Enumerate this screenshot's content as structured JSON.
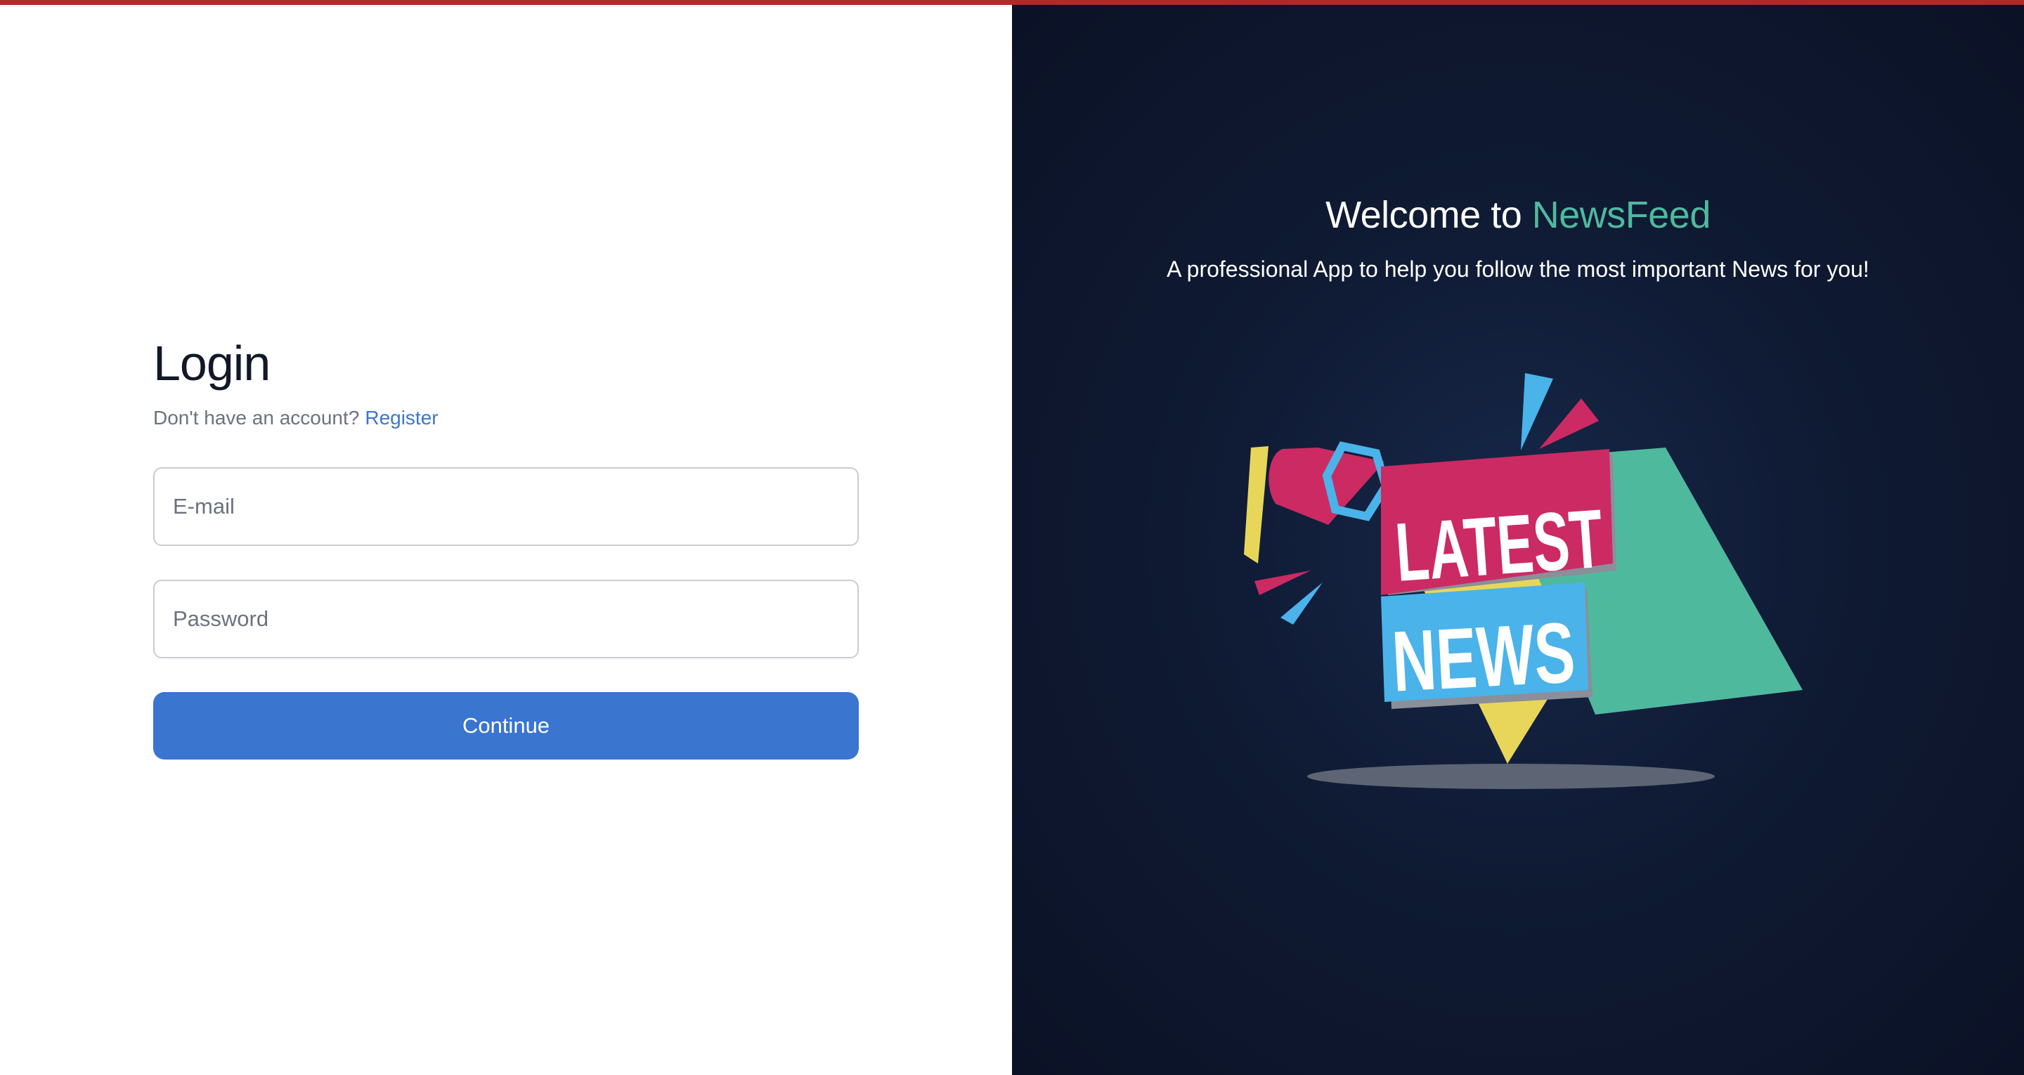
{
  "login": {
    "title": "Login",
    "no_account_text": "Don't have an account?",
    "register_label": "Register",
    "email_placeholder": "E-mail",
    "password_placeholder": "Password",
    "continue_label": "Continue"
  },
  "hero": {
    "welcome_prefix": "Welcome to",
    "brand_name": "NewsFeed",
    "tagline": "A professional App to help you follow the most important News for you!",
    "illustration": {
      "icon": "latest-news-megaphone-illustration",
      "line1": "LATEST",
      "line2": "NEWS"
    }
  },
  "colors": {
    "top_bar": "#b02a2a",
    "primary_button": "#3a75cf",
    "link": "#3b76cf",
    "brand_accent": "#4fb99e",
    "hero_background": "#0f1a33"
  }
}
